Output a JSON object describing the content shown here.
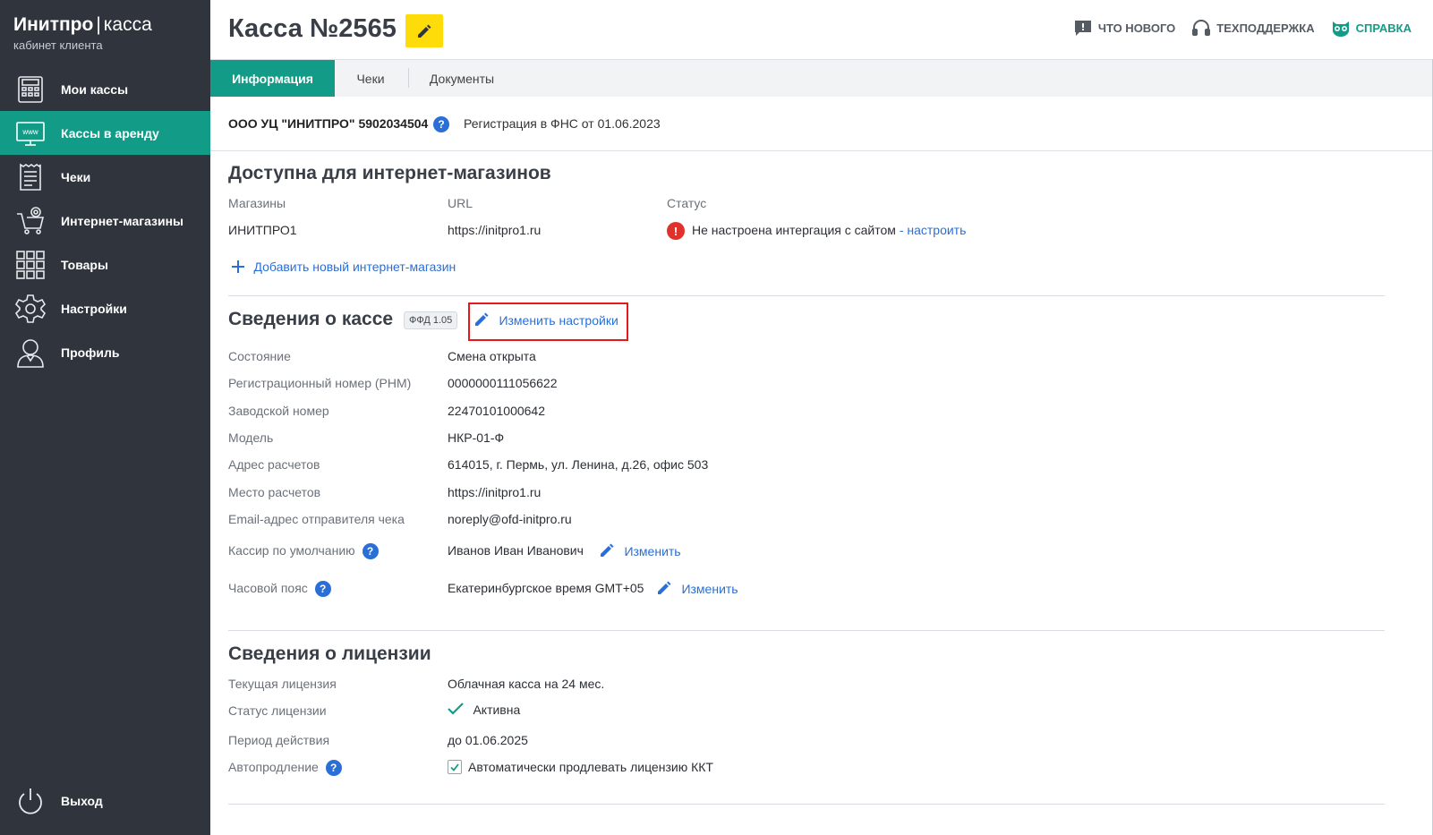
{
  "brand": {
    "name_bold": "Инитпро",
    "separator": "|",
    "name_light": "касса",
    "subtitle": "кабинет клиента"
  },
  "sidebar": {
    "items": [
      {
        "label": "Мои кассы",
        "icon": "cash-register-icon"
      },
      {
        "label": "Кассы в аренду",
        "icon": "www-monitor-icon",
        "active": true
      },
      {
        "label": "Чеки",
        "icon": "receipt-icon"
      },
      {
        "label": "Интернет-магазины",
        "icon": "cart-at-icon"
      },
      {
        "label": "Товары",
        "icon": "grid-icon"
      },
      {
        "label": "Настройки",
        "icon": "gear-icon"
      },
      {
        "label": "Профиль",
        "icon": "user-icon"
      }
    ],
    "logout": {
      "label": "Выход",
      "icon": "power-icon"
    }
  },
  "header": {
    "title": "Касса №2565",
    "links": [
      {
        "label": "Что нового",
        "icon": "chat-alert-icon"
      },
      {
        "label": "Техподдержка",
        "icon": "headset-icon"
      },
      {
        "label": "Справка",
        "icon": "owl-icon"
      }
    ]
  },
  "tabs": [
    {
      "label": "Информация",
      "active": true
    },
    {
      "label": "Чеки"
    },
    {
      "label": "Документы"
    }
  ],
  "org": {
    "name": "ООО УЦ \"ИНИТПРО\" 5902034504",
    "help": "?",
    "registration": "Регистрация в ФНС от 01.06.2023"
  },
  "shops": {
    "title": "Доступна для интернет-магазинов",
    "columns": [
      "Магазины",
      "URL",
      "Статус"
    ],
    "rows": [
      {
        "shop": "ИНИТПРО1",
        "url": "https://initpro1.ru",
        "status": "Не настроена интергация с сайтом",
        "status_link": "- настроить"
      }
    ],
    "add_label": "Добавить новый интернет-магазин"
  },
  "kassa": {
    "title": "Сведения о кассе",
    "badge": "ФФД 1.05",
    "edit_label": "Изменить настройки",
    "rows": [
      {
        "label": "Состояние",
        "value": "Смена открыта"
      },
      {
        "label": "Регистрационный номер (РНМ)",
        "value": "0000000111056622"
      },
      {
        "label": "Заводской номер",
        "value": "22470101000642"
      },
      {
        "label": "Модель",
        "value": "НКР-01-Ф"
      },
      {
        "label": "Адрес расчетов",
        "value": "614015, г. Пермь, ул. Ленина, д.26, офис 503"
      },
      {
        "label": "Место расчетов",
        "value": "https://initpro1.ru"
      },
      {
        "label": "Email-адрес отправителя чека",
        "value": "noreply@ofd-initpro.ru"
      }
    ],
    "cashier": {
      "label": "Кассир по умолчанию",
      "value": "Иванов Иван Иванович",
      "action": "Изменить"
    },
    "timezone": {
      "label": "Часовой пояс",
      "value": "Екатеринбургское время GMT+05",
      "action": "Изменить"
    }
  },
  "license": {
    "title": "Сведения о лицензии",
    "current": {
      "label": "Текущая лицензия",
      "value": "Облачная касса на 24 мес."
    },
    "status": {
      "label": "Статус лицензии",
      "value": "Активна"
    },
    "period": {
      "label": "Период действия",
      "value": "до 01.06.2025"
    },
    "autorenew": {
      "label": "Автопродление",
      "value": "Автоматически продлевать лицензию ККТ",
      "checked": true
    }
  },
  "colors": {
    "sidebar": "#2f343d",
    "accent": "#129c87",
    "link": "#2a6fd6",
    "highlight_box": "#e11b1b",
    "title_button": "#fddc0a"
  }
}
